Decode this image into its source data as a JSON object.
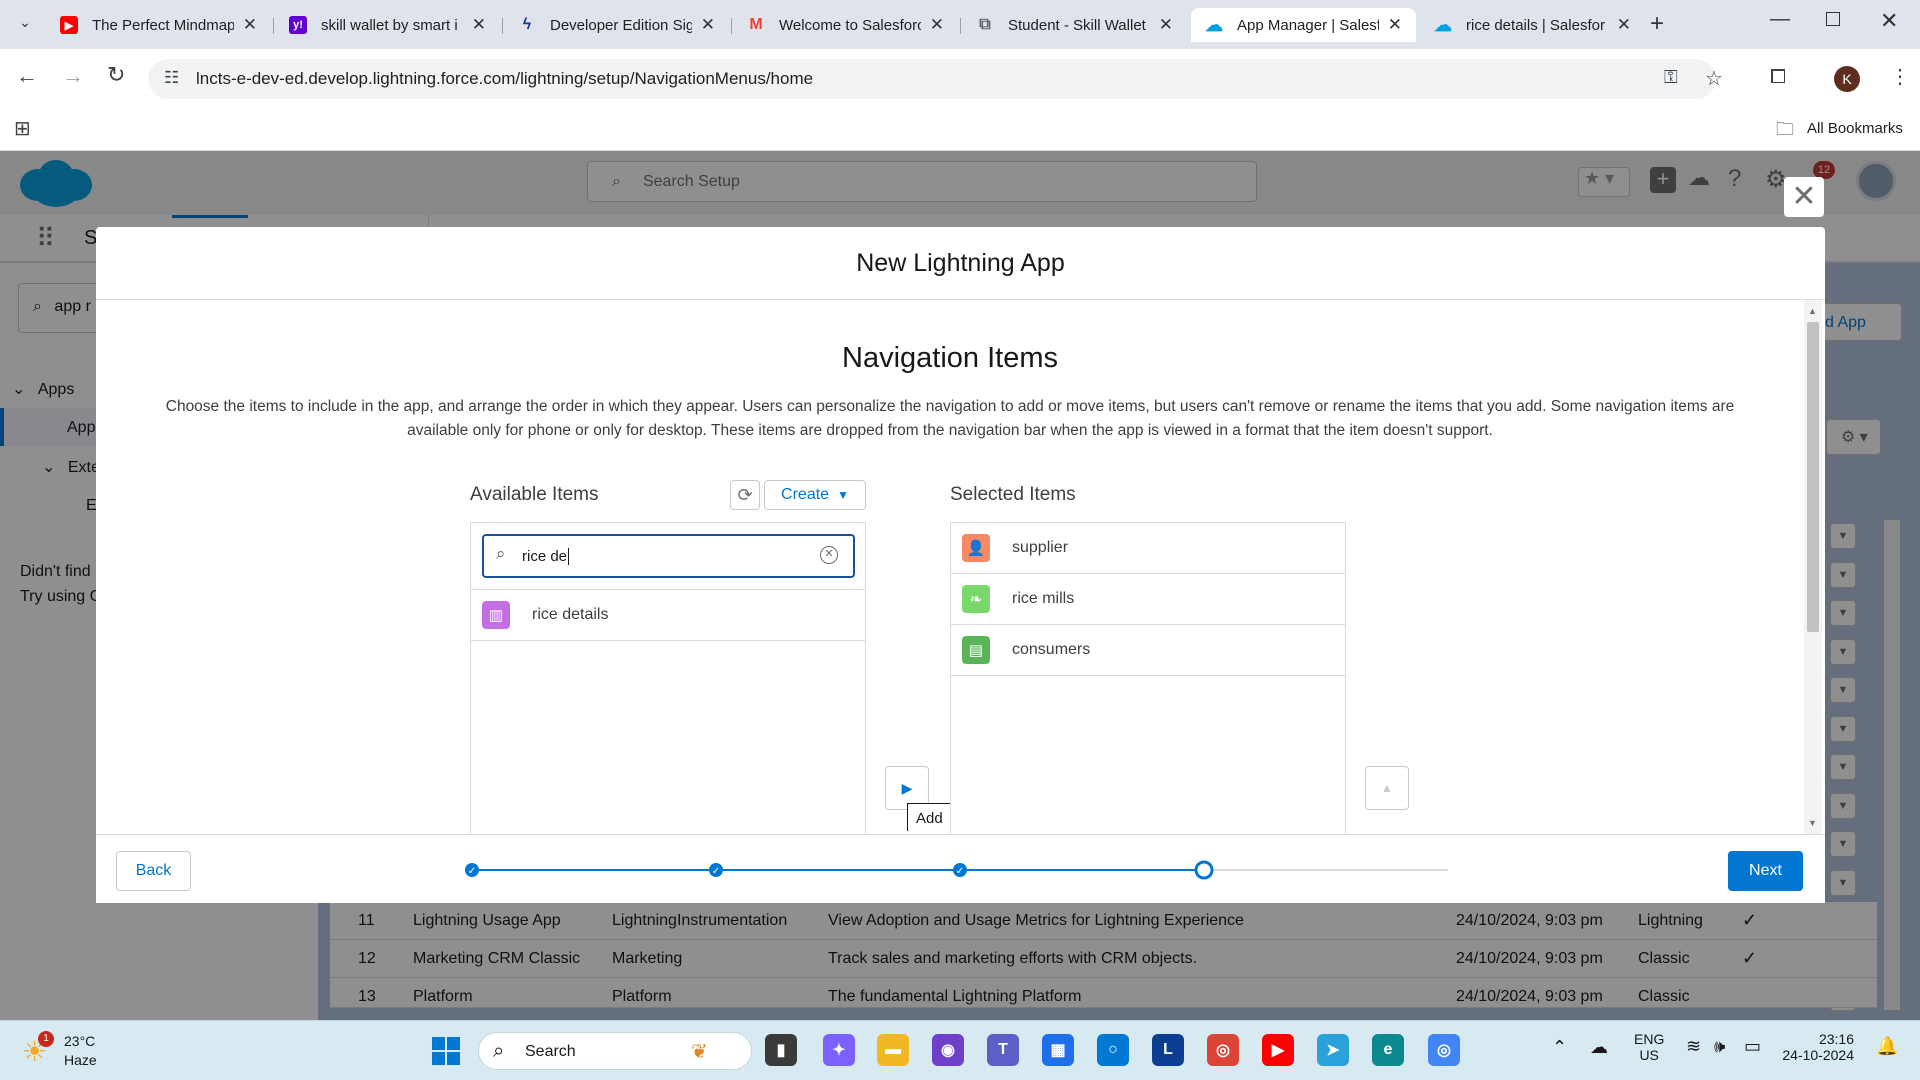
{
  "browser": {
    "tabs": [
      {
        "title": "The Perfect Mindmap",
        "favicon_color": "#ff0000",
        "favicon": "▶"
      },
      {
        "title": "skill wallet by smart i",
        "favicon_color": "#6001d2",
        "favicon": "y!"
      },
      {
        "title": "Developer Edition Sig",
        "favicon_color": "#1a3a8a",
        "favicon": "ϟ"
      },
      {
        "title": "Welcome to Salesforc",
        "favicon_color": "#ea4335",
        "favicon": "M"
      },
      {
        "title": "Student - Skill Wallet",
        "favicon_color": "#5f6368",
        "favicon": "⧉"
      },
      {
        "title": "App Manager | Salesf",
        "favicon_color": "#00a1e0",
        "favicon": "☁",
        "active": true
      },
      {
        "title": "rice details | Salesfor",
        "favicon_color": "#00a1e0",
        "favicon": "☁"
      }
    ],
    "url": "lncts-e-dev-ed.develop.lightning.force.com/lightning/setup/NavigationMenus/home",
    "bookmarks_label": "All Bookmarks",
    "profile_initial": "K"
  },
  "sf": {
    "search_placeholder": "Search Setup",
    "nav_letter": "S",
    "notification_count": "12",
    "left_search_value": "app r",
    "left_tree": {
      "apps": "Apps",
      "app_manager": "App",
      "external": "Exte",
      "ext_child": "E"
    },
    "not_found_1": "Didn't find",
    "not_found_2": "Try using G",
    "new_app_button": "d App",
    "rows": [
      {
        "num": "11",
        "app": "Lightning Usage App",
        "dev": "LightningInstrumentation",
        "desc": "View Adoption and Usage Metrics for Lightning Experience",
        "date": "24/10/2024, 9:03 pm",
        "type": "Lightning",
        "check": "✓"
      },
      {
        "num": "12",
        "app": "Marketing CRM Classic",
        "dev": "Marketing",
        "desc": "Track sales and marketing efforts with CRM objects.",
        "date": "24/10/2024, 9:03 pm",
        "type": "Classic",
        "check": "✓"
      },
      {
        "num": "13",
        "app": "Platform",
        "dev": "Platform",
        "desc": "The fundamental Lightning Platform",
        "date": "24/10/2024, 9:03 pm",
        "type": "Classic",
        "check": ""
      }
    ]
  },
  "modal": {
    "title": "New Lightning App",
    "section_title": "Navigation Items",
    "description": "Choose the items to include in the app, and arrange the order in which they appear. Users can personalize the navigation to add or move items, but users can't remove or rename the items that you add. Some navigation items are available only for phone or only for desktop. These items are dropped from the navigation bar when the app is viewed in a format that the item doesn't support.",
    "available_label": "Available Items",
    "create_label": "Create",
    "search_value": "rice de",
    "available_items": [
      {
        "label": "rice details",
        "icon_color": "#c46ee6",
        "icon": "board-icon"
      }
    ],
    "selected_label": "Selected Items",
    "selected_items": [
      {
        "label": "supplier",
        "icon_color": "#f88962",
        "icon": "contact-icon"
      },
      {
        "label": "rice mills",
        "icon_color": "#78d86a",
        "icon": "leaf-icon"
      },
      {
        "label": "consumers",
        "icon_color": "#5ab55a",
        "icon": "card-icon"
      }
    ],
    "add_tooltip": "Add",
    "back_label": "Back",
    "next_label": "Next",
    "steps_completed": 3,
    "steps_total": 4
  },
  "taskbar": {
    "weather_temp": "23°C",
    "weather_desc": "Haze",
    "weather_badge": "1",
    "search_label": "Search",
    "lang_1": "ENG",
    "lang_2": "US",
    "time": "23:16",
    "date": "24-10-2024"
  },
  "colors": {
    "brand": "#0176d3",
    "sf_cloud": "#00a1e0"
  }
}
